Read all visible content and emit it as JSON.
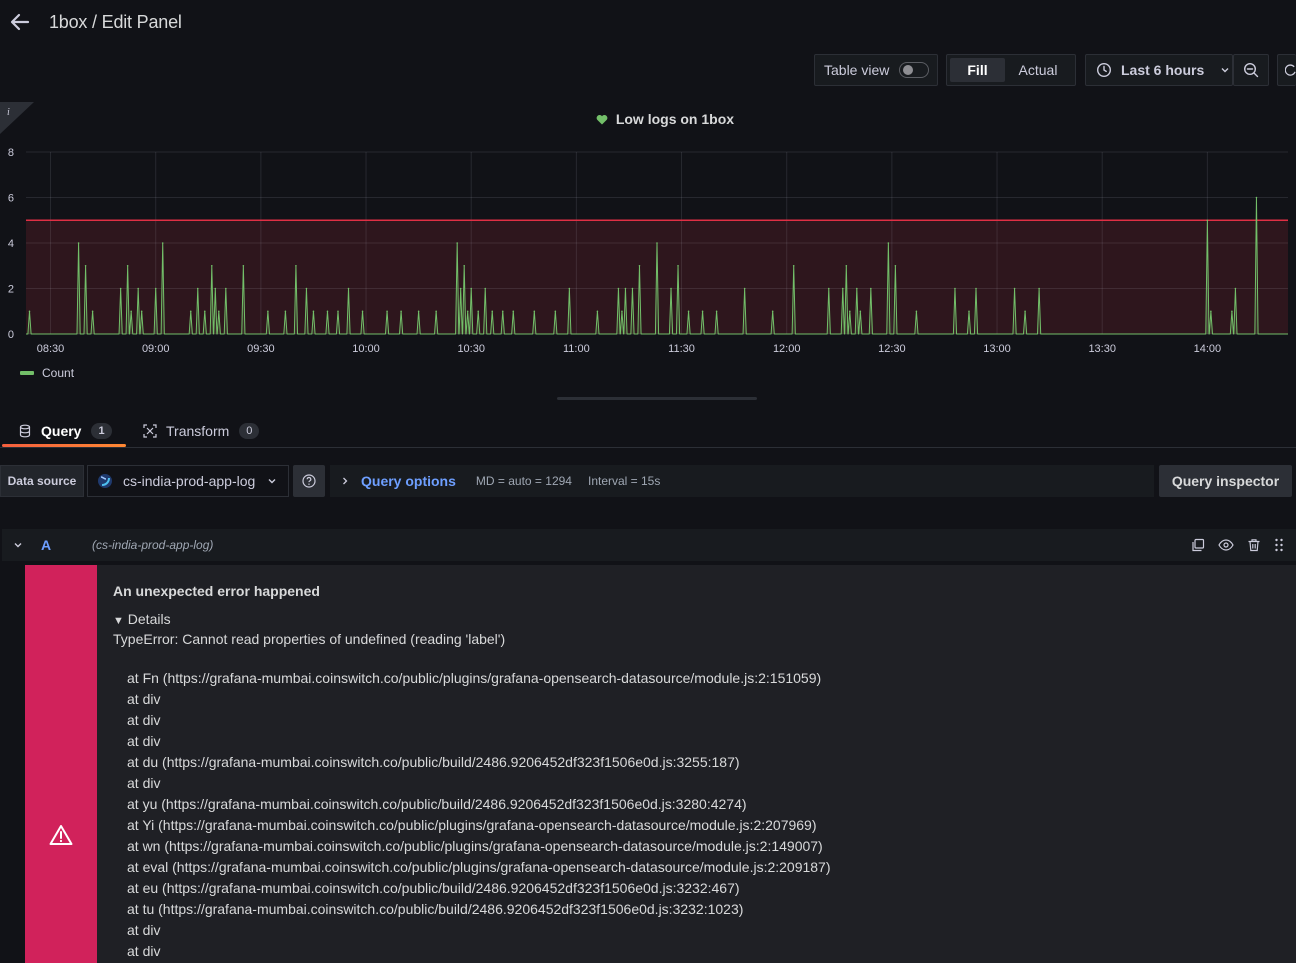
{
  "header": {
    "title": "1box / Edit Panel"
  },
  "toolbar": {
    "table_view_label": "Table view",
    "fill_label": "Fill",
    "actual_label": "Actual",
    "time_range_label": "Last 6 hours"
  },
  "panel": {
    "title": "Low logs on 1box",
    "legend_label": "Count"
  },
  "chart_data": {
    "type": "line",
    "title": "Low logs on 1box",
    "x_ticks": [
      "08:30",
      "09:00",
      "09:30",
      "10:00",
      "10:30",
      "11:00",
      "11:30",
      "12:00",
      "12:30",
      "13:00",
      "13:30",
      "14:00"
    ],
    "y_ticks": [
      0,
      2,
      4,
      6,
      8
    ],
    "ylim": [
      0,
      8
    ],
    "xlim": [
      "08:23",
      "14:23"
    ],
    "threshold": 5,
    "series": [
      {
        "name": "Count",
        "color": "#73bf69",
        "spikes": [
          [
            "08:24",
            1
          ],
          [
            "08:38",
            4
          ],
          [
            "08:40",
            3
          ],
          [
            "08:42",
            1
          ],
          [
            "08:50",
            2
          ],
          [
            "08:52",
            3
          ],
          [
            "08:53",
            1
          ],
          [
            "08:55",
            2
          ],
          [
            "08:56",
            1
          ],
          [
            "09:00",
            2
          ],
          [
            "09:02",
            4
          ],
          [
            "09:10",
            1
          ],
          [
            "09:12",
            2
          ],
          [
            "09:14",
            1
          ],
          [
            "09:16",
            3
          ],
          [
            "09:17",
            2
          ],
          [
            "09:18",
            1
          ],
          [
            "09:20",
            2
          ],
          [
            "09:25",
            3
          ],
          [
            "09:32",
            1
          ],
          [
            "09:37",
            1
          ],
          [
            "09:40",
            3
          ],
          [
            "09:43",
            2
          ],
          [
            "09:45",
            1
          ],
          [
            "09:49",
            1
          ],
          [
            "09:52",
            1
          ],
          [
            "09:55",
            2
          ],
          [
            "09:59",
            1
          ],
          [
            "10:06",
            1
          ],
          [
            "10:10",
            1
          ],
          [
            "10:15",
            1
          ],
          [
            "10:20",
            1
          ],
          [
            "10:26",
            4
          ],
          [
            "10:27",
            2
          ],
          [
            "10:28",
            3
          ],
          [
            "10:29",
            1
          ],
          [
            "10:30",
            2
          ],
          [
            "10:32",
            1
          ],
          [
            "10:34",
            2
          ],
          [
            "10:36",
            1
          ],
          [
            "10:39",
            1
          ],
          [
            "10:42",
            1
          ],
          [
            "10:48",
            1
          ],
          [
            "10:54",
            1
          ],
          [
            "10:58",
            2
          ],
          [
            "11:06",
            1
          ],
          [
            "11:12",
            2
          ],
          [
            "11:13",
            1
          ],
          [
            "11:14",
            2
          ],
          [
            "11:16",
            2
          ],
          [
            "11:18",
            3
          ],
          [
            "11:23",
            4
          ],
          [
            "11:27",
            2
          ],
          [
            "11:29",
            3
          ],
          [
            "11:32",
            1
          ],
          [
            "11:36",
            1
          ],
          [
            "11:40",
            1
          ],
          [
            "11:48",
            2
          ],
          [
            "11:56",
            1
          ],
          [
            "12:02",
            3
          ],
          [
            "12:12",
            2
          ],
          [
            "12:16",
            2
          ],
          [
            "12:17",
            3
          ],
          [
            "12:18",
            1
          ],
          [
            "12:20",
            2
          ],
          [
            "12:21",
            1
          ],
          [
            "12:24",
            2
          ],
          [
            "12:29",
            4
          ],
          [
            "12:31",
            3
          ],
          [
            "12:37",
            1
          ],
          [
            "12:48",
            2
          ],
          [
            "12:52",
            1
          ],
          [
            "12:54",
            2
          ],
          [
            "13:05",
            2
          ],
          [
            "13:08",
            1
          ],
          [
            "13:12",
            2
          ],
          [
            "14:00",
            5
          ],
          [
            "14:01",
            1
          ],
          [
            "14:07",
            1
          ],
          [
            "14:08",
            2
          ],
          [
            "14:14",
            6
          ]
        ]
      }
    ],
    "grid": true,
    "legend": "bottom-left"
  },
  "tabs": [
    {
      "label": "Query",
      "count": "1"
    },
    {
      "label": "Transform",
      "count": "0"
    }
  ],
  "datasource": {
    "label": "Data source",
    "selected": "cs-india-prod-app-log",
    "query_options_label": "Query options",
    "md_info": "MD = auto = 1294",
    "interval_info": "Interval = 15s",
    "inspector_label": "Query inspector"
  },
  "query": {
    "ref_id": "A",
    "datasource_hint": "(cs-india-prod-app-log)"
  },
  "error": {
    "title": "An unexpected error happened",
    "details_label": "Details",
    "message": "TypeError: Cannot read properties of undefined (reading 'label')",
    "stack": [
      "at Fn (https://grafana-mumbai.coinswitch.co/public/plugins/grafana-opensearch-datasource/module.js:2:151059)",
      "at div",
      "at div",
      "at div",
      "at du (https://grafana-mumbai.coinswitch.co/public/build/2486.9206452df323f1506e0d.js:3255:187)",
      "at div",
      "at yu (https://grafana-mumbai.coinswitch.co/public/build/2486.9206452df323f1506e0d.js:3280:4274)",
      "at Yi (https://grafana-mumbai.coinswitch.co/public/plugins/grafana-opensearch-datasource/module.js:2:207969)",
      "at wn (https://grafana-mumbai.coinswitch.co/public/plugins/grafana-opensearch-datasource/module.js:2:149007)",
      "at eval (https://grafana-mumbai.coinswitch.co/public/plugins/grafana-opensearch-datasource/module.js:2:209187)",
      "at eu (https://grafana-mumbai.coinswitch.co/public/build/2486.9206452df323f1506e0d.js:3232:467)",
      "at tu (https://grafana-mumbai.coinswitch.co/public/build/2486.9206452df323f1506e0d.js:3232:1023)",
      "at div",
      "at div"
    ]
  },
  "colors": {
    "background": "#111217",
    "series": "#73bf69",
    "threshold": "#e02f44",
    "error": "#d1225b",
    "link": "#6e9fff",
    "tab_accent": "#f55f3e"
  }
}
